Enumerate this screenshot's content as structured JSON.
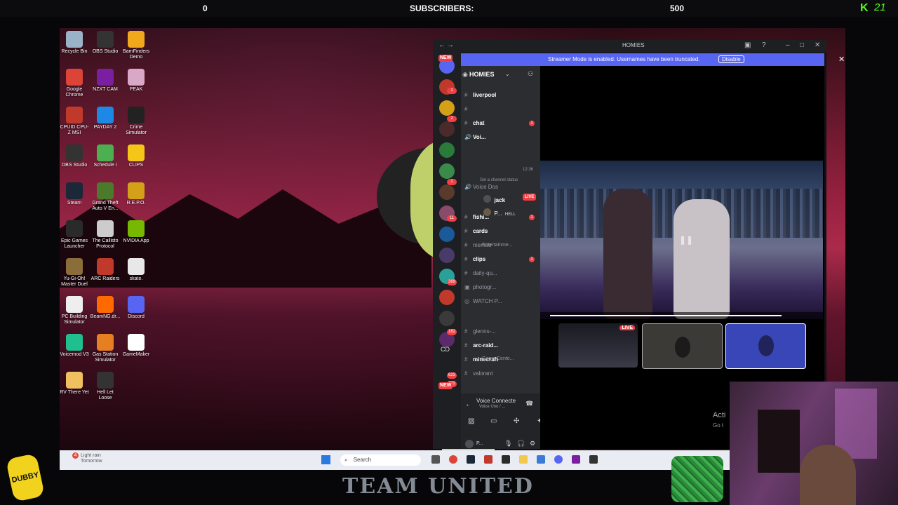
{
  "topbar": {
    "left_count": "0",
    "label": "SUBSCRIBERS:",
    "goal": "500",
    "brand": "K",
    "brand_num": "21"
  },
  "desktop_icons": [
    {
      "label": "Recycle Bin",
      "color": "#9bb3c8"
    },
    {
      "label": "OBS Studio",
      "color": "#333333"
    },
    {
      "label": "BarnFinders Demo",
      "color": "#f2a81c"
    },
    {
      "label": "Google Chrome",
      "color": "#db4437"
    },
    {
      "label": "NZXT CAM",
      "color": "#7a1fa2"
    },
    {
      "label": "PEAK",
      "color": "#d9a8c6"
    },
    {
      "label": "CPUID CPU-Z MSI",
      "color": "#c0392b"
    },
    {
      "label": "PAYDAY 2",
      "color": "#1e88e5"
    },
    {
      "label": "Crime Simulator",
      "color": "#222222"
    },
    {
      "label": "OBS Studio",
      "color": "#333333"
    },
    {
      "label": "Schedule I",
      "color": "#4caf50"
    },
    {
      "label": "CLIPS",
      "color": "#f5c518"
    },
    {
      "label": "Steam",
      "color": "#1b2838"
    },
    {
      "label": "Grand Theft Auto V En...",
      "color": "#4a7a2a"
    },
    {
      "label": "R.E.P.O.",
      "color": "#d4a017"
    },
    {
      "label": "Epic Games Launcher",
      "color": "#2a2a2a"
    },
    {
      "label": "The Callisto Protocol",
      "color": "#cccccc"
    },
    {
      "label": "NVIDIA App",
      "color": "#76b900"
    },
    {
      "label": "Yu-Gi-Oh! Master Duel",
      "color": "#8a6d3b"
    },
    {
      "label": "ARC Raiders",
      "color": "#c0392b"
    },
    {
      "label": "skate.",
      "color": "#e8e8e8"
    },
    {
      "label": "PC Building Simulator",
      "color": "#eeeeee"
    },
    {
      "label": "BeamNG.dr...",
      "color": "#ff6a00"
    },
    {
      "label": "Discord",
      "color": "#5865f2"
    },
    {
      "label": "Voicemod V3",
      "color": "#1fbf8f"
    },
    {
      "label": "Gas Station Simulator",
      "color": "#e67e22"
    },
    {
      "label": "GameMaker",
      "color": "#ffffff"
    },
    {
      "label": "RV There Yet",
      "color": "#f0c060"
    },
    {
      "label": "Hell Let Loose",
      "color": "#333333"
    }
  ],
  "discord": {
    "window_title": "HOMIES",
    "streamer_msg": "Streamer Mode is enabled. Usernames have been truncated.",
    "disable_label": "Disable",
    "server_name": "HOMIES",
    "guild_badges": [
      "NEW",
      "1",
      "2",
      "1",
      "11",
      "369",
      "162",
      "623",
      "211",
      "NEW"
    ],
    "guild_initials": "CD",
    "channels": [
      {
        "icon": "#",
        "name": "liverpool",
        "bold": true,
        "dot": ""
      },
      {
        "icon": "#",
        "name": "",
        "bold": true,
        "dot": ""
      },
      {
        "icon": "#",
        "name": "chat",
        "bold": true,
        "dot": "1"
      },
      {
        "icon": "🔊",
        "name": "Voi...",
        "bold": true,
        "dot": ""
      },
      {
        "icon": "🔊",
        "name": "Voice Dos",
        "bold": false,
        "dot": ""
      },
      {
        "icon": "#",
        "name": "fishi...",
        "bold": true,
        "dot": "1"
      },
      {
        "icon": "#",
        "name": "cards",
        "bold": true,
        "dot": ""
      },
      {
        "icon": "#",
        "name": "memes",
        "bold": false,
        "dot": ""
      },
      {
        "icon": "#",
        "name": "clips",
        "bold": true,
        "dot": "1"
      },
      {
        "icon": "#",
        "name": "daily-qu...",
        "bold": false,
        "dot": ""
      },
      {
        "icon": "▣",
        "name": "photogr...",
        "bold": false,
        "dot": ""
      },
      {
        "icon": "◎",
        "name": "WATCH P...",
        "bold": false,
        "dot": ""
      },
      {
        "icon": "#",
        "name": "glenns-...",
        "bold": false,
        "dot": ""
      },
      {
        "icon": "#",
        "name": "arc-raid...",
        "bold": true,
        "dot": ""
      },
      {
        "icon": "#",
        "name": "minecraft",
        "bold": true,
        "dot": ""
      },
      {
        "icon": "#",
        "name": "valorant",
        "bold": false,
        "dot": ""
      }
    ],
    "voice_time": "12:36",
    "channel_status": "Set a channel status",
    "voice_users": [
      {
        "name": "jack",
        "live": "LIVE"
      },
      {
        "name": "P...",
        "tag": "HELL"
      }
    ],
    "categories": [
      "Entertainme...",
      "Game Cente..."
    ],
    "voice_connected": "Voice Connecte",
    "voice_sub": "Voice Uno / ...",
    "user_short": "P...",
    "tile_live": "LIVE"
  },
  "taskbar": {
    "weather_badge": "4",
    "weather_line1": "Light rain",
    "weather_line2": "Tomorrow",
    "search_placeholder": "Search"
  },
  "overlay": {
    "team": "TEAM UNITED",
    "dubby": "DUBBY",
    "activate1": "Acti",
    "activate2": "Go t"
  }
}
